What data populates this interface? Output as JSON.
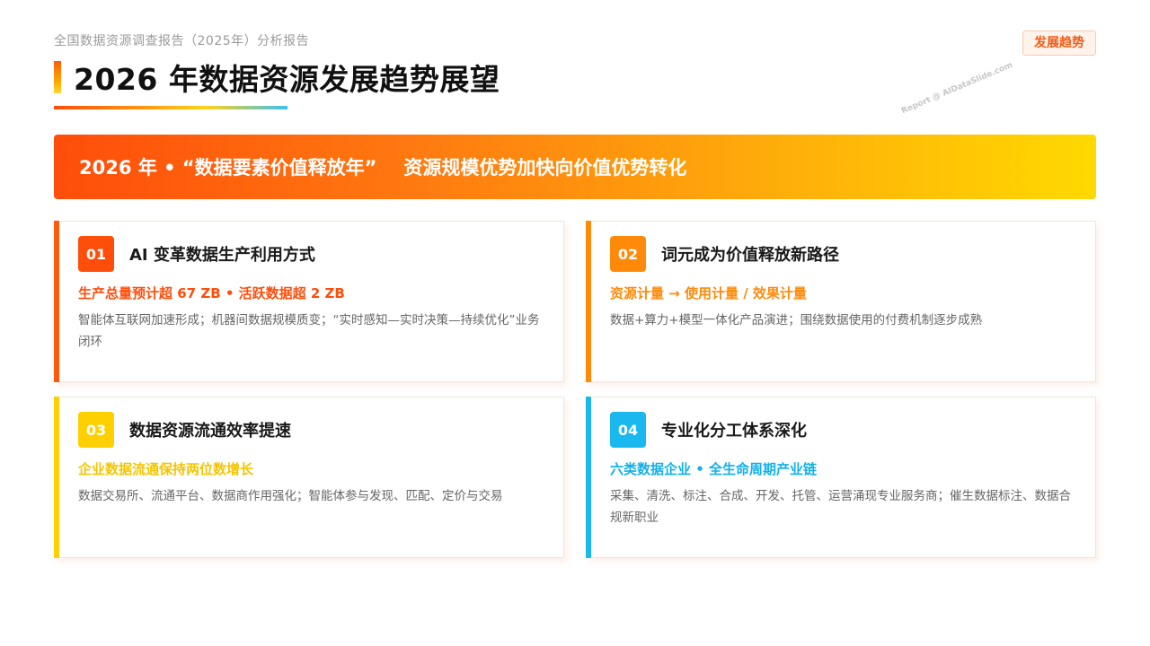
{
  "header": {
    "supertitle": "全国数据资源调查报告（2025年）分析报告",
    "title": "2026 年数据资源发展趋势展望",
    "tag": "发展趋势",
    "watermark": "Report @ AIDataSlide.com"
  },
  "banner": {
    "left": "2026 年 • “数据要素价值释放年”",
    "right": "资源规模优势加快向价值优势转化"
  },
  "cards": [
    {
      "num": "01",
      "title": "AI 变革数据生产利用方式",
      "subtitle": "生产总量预计超 67 ZB • 活跃数据超 2 ZB",
      "desc": "智能体互联网加速形成；机器间数据规模质变；“实时感知—实时决策—持续优化”业务闭环",
      "accent": "#ff4d0a"
    },
    {
      "num": "02",
      "title": "词元成为价值释放新路径",
      "subtitle": "资源计量 → 使用计量 / 效果计量",
      "desc": "数据+算力+模型一体化产品演进；围绕数据使用的付费机制逐步成熟",
      "accent": "#ff8a0a"
    },
    {
      "num": "03",
      "title": "数据资源流通效率提速",
      "subtitle": "企业数据流通保持两位数增长",
      "desc": "数据交易所、流通平台、数据商作用强化；智能体参与发现、匹配、定价与交易",
      "accent": "#ffd000"
    },
    {
      "num": "04",
      "title": "专业化分工体系深化",
      "subtitle": "六类数据企业 • 全生命周期产业链",
      "desc": "采集、清洗、标注、合成、开发、托管、运营涌现专业服务商；催生数据标注、数据合规新职业",
      "accent": "#19b8ef"
    }
  ]
}
